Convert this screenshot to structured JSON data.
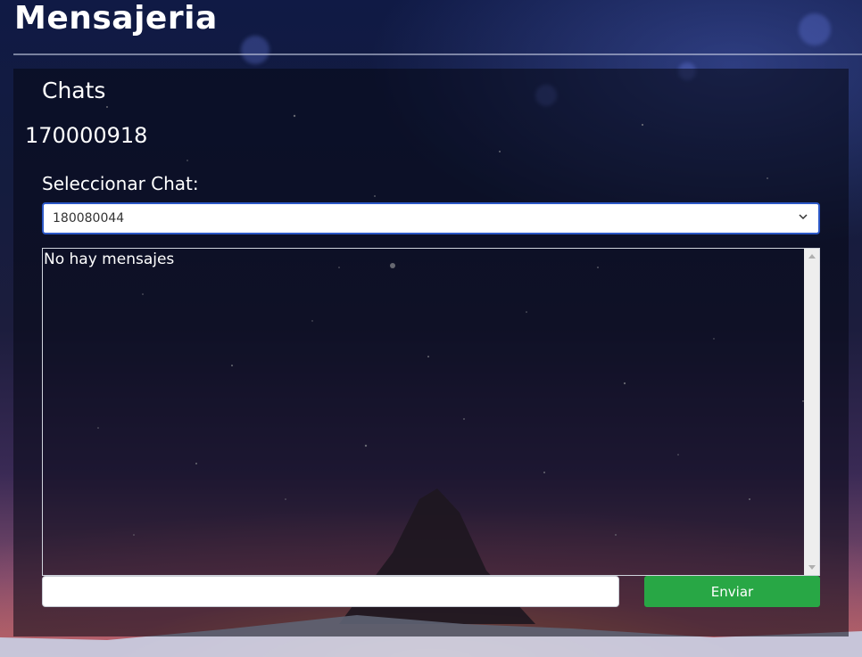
{
  "header": {
    "title": "Mensajeria"
  },
  "chats": {
    "title": "Chats",
    "user_id": "170000918",
    "select_label": "Seleccionar Chat:",
    "selected_chat": "180080044"
  },
  "messages": {
    "empty_text": "No hay mensajes"
  },
  "composer": {
    "input_value": "",
    "input_placeholder": "",
    "send_label": "Enviar"
  },
  "icons": {
    "select_chevron": "chevron-down-icon",
    "scroll_up": "scroll-up-arrow-icon",
    "scroll_down": "scroll-down-arrow-icon"
  },
  "colors": {
    "send_button": "#28a745",
    "select_border": "#2c58c7",
    "text": "#ffffff"
  }
}
